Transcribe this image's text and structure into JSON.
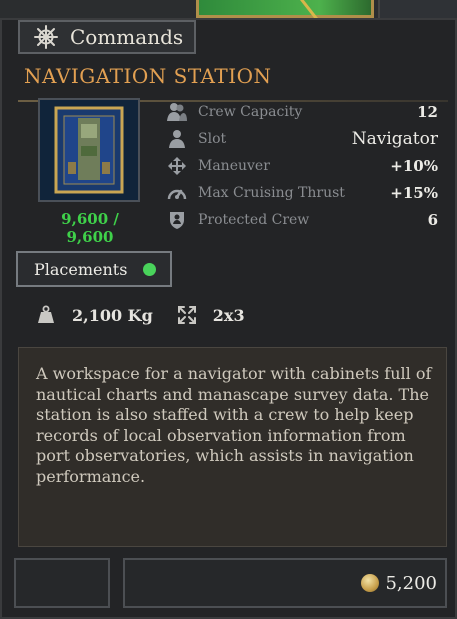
{
  "tab": {
    "label": "Commands",
    "icon": "ship-wheel-icon"
  },
  "item": {
    "title": "NAVIGATION STATION",
    "hp": "9,600 / 9,600",
    "stats": [
      {
        "icon": "crew-icon",
        "label": "Crew Capacity",
        "value": "12"
      },
      {
        "icon": "slot-icon",
        "label": "Slot",
        "value": "Navigator"
      },
      {
        "icon": "maneuver-icon",
        "label": "Maneuver",
        "value": "+10%"
      },
      {
        "icon": "speedometer-icon",
        "label": "Max Cruising Thrust",
        "value": "+15%"
      },
      {
        "icon": "shield-crew-icon",
        "label": "Protected Crew",
        "value": "6"
      }
    ],
    "placements_label": "Placements",
    "weight": "2,100 Kg",
    "size": "2x3",
    "description": "A workspace for a navigator with cabinets full of nautical charts and manascape survey data. The station is also staffed with a crew to help keep records of local observation information from port observatories, which assists in navigation performance.",
    "price": "5,200"
  },
  "colors": {
    "title": "#e2a052",
    "hp": "#3fd14a",
    "status_dot": "#49d35b"
  }
}
